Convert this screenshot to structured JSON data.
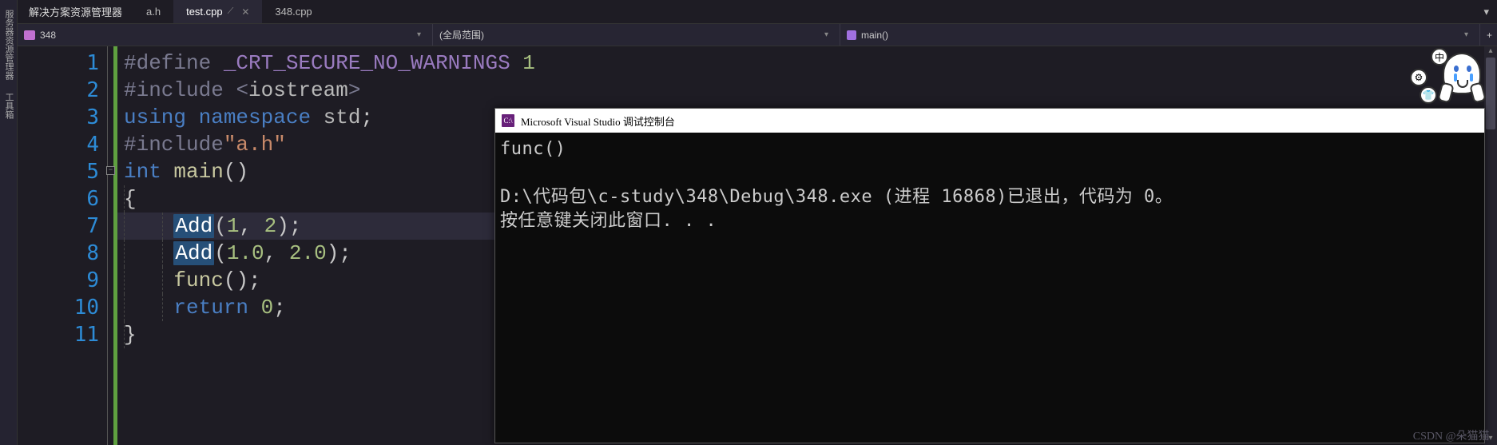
{
  "left_sidebar": {
    "tab1": "服务器资源管理器",
    "tab2": "工具箱"
  },
  "tabbar": {
    "solution_explorer": "解决方案资源管理器",
    "tabs": [
      {
        "label": "a.h",
        "active": false
      },
      {
        "label": "test.cpp",
        "active": true
      },
      {
        "label": "348.cpp",
        "active": false
      }
    ],
    "dropdown_glyph": "▾"
  },
  "navbar": {
    "scope_left": "348",
    "scope_mid": "(全局范围)",
    "scope_right": "main()",
    "plus": "+"
  },
  "code": {
    "lines": [
      {
        "n": 1,
        "html": "<span class='kw-def'>#define</span> <span class='macro'>_CRT_SECURE_NO_WARNINGS</span> <span class='num'>1</span>"
      },
      {
        "n": 2,
        "html": "<span class='kw-def'>#include</span> <span class='kw-def'>&lt;</span><span class='ident'>iostream</span><span class='kw-def'>&gt;</span>"
      },
      {
        "n": 3,
        "html": "<span class='kw-blue'>using</span> <span class='kw-blue'>namespace</span> <span class='ident'>std</span>;"
      },
      {
        "n": 4,
        "html": "<span class='kw-def'>#include</span><span class='str'>\"a.h\"</span>"
      },
      {
        "n": 5,
        "html": "<span class='kw-blue'>int</span> <span class='fn'>main</span>()"
      },
      {
        "n": 6,
        "html": "{"
      },
      {
        "n": 7,
        "html": "    <span class='sel'>Add</span>(<span class='num'>1</span>, <span class='num'>2</span>);"
      },
      {
        "n": 8,
        "html": "    <span class='sel'>Add</span>(<span class='num'>1.0</span>, <span class='num'>2.0</span>);"
      },
      {
        "n": 9,
        "html": "    <span class='fn'>func</span>();"
      },
      {
        "n": 10,
        "html": "    <span class='kw-blue'>return</span> <span class='num'>0</span>;"
      },
      {
        "n": 11,
        "html": "}"
      }
    ]
  },
  "console": {
    "title": "Microsoft Visual Studio 调试控制台",
    "icon_text": "C:\\",
    "output": "func()\n\nD:\\代码包\\c-study\\348\\Debug\\348.exe (进程 16868)已退出，代码为 0。\n按任意键关闭此窗口. . ."
  },
  "sticker": {
    "b1": "中",
    "b2": "⚙",
    "b3": "👕"
  },
  "watermark": "CSDN @朵猫猫."
}
